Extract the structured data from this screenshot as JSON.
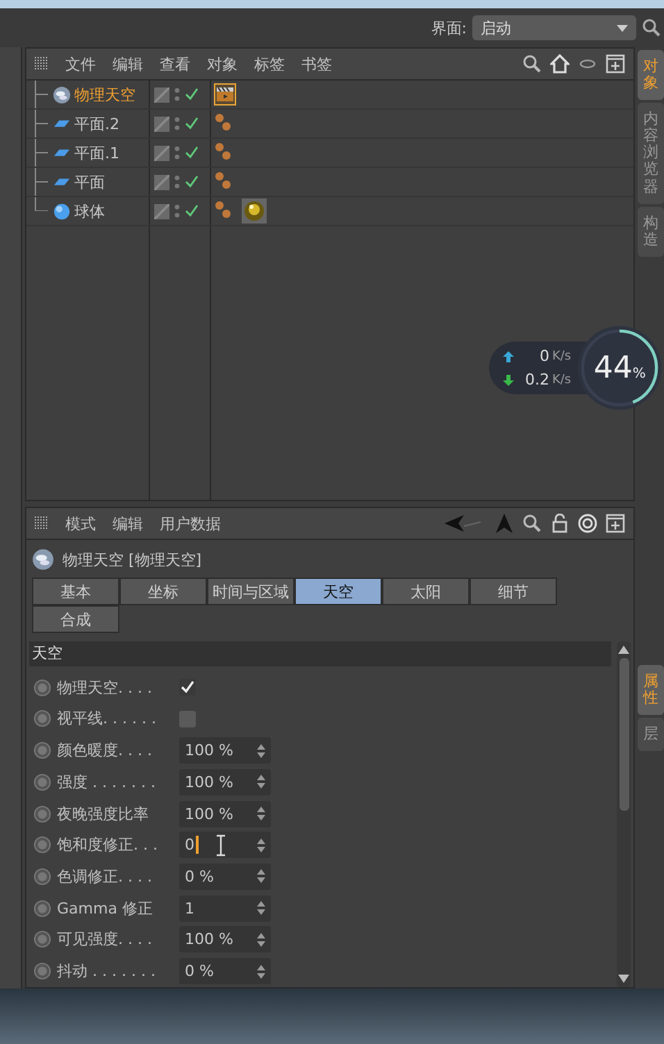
{
  "top_bar": {
    "layout_label": "界面:",
    "layout_value": "启动"
  },
  "object_manager": {
    "menu": [
      "文件",
      "编辑",
      "查看",
      "对象",
      "标签",
      "书签"
    ],
    "objects": [
      {
        "name": "物理天空",
        "kind": "sky",
        "selected": true,
        "tags": [
          {
            "kind": "clapper",
            "selected": true
          }
        ]
      },
      {
        "name": "平面.2",
        "kind": "plane",
        "selected": false,
        "tags": [
          {
            "kind": "dots",
            "selected": false
          }
        ]
      },
      {
        "name": "平面.1",
        "kind": "plane",
        "selected": false,
        "tags": [
          {
            "kind": "dots",
            "selected": false
          }
        ]
      },
      {
        "name": "平面",
        "kind": "plane",
        "selected": false,
        "tags": [
          {
            "kind": "dots",
            "selected": false
          }
        ]
      },
      {
        "name": "球体",
        "kind": "sphere",
        "selected": false,
        "tags": [
          {
            "kind": "dots",
            "selected": false
          },
          {
            "kind": "material",
            "selected": false
          }
        ]
      }
    ]
  },
  "side_tabs_top": [
    {
      "label": "对象",
      "selected": true
    },
    {
      "label": "内容浏览器",
      "selected": false
    },
    {
      "label": "构造",
      "selected": false
    }
  ],
  "net_widget": {
    "upload": "0",
    "upload_unit": "K/s",
    "download": "0.2",
    "download_unit": "K/s",
    "percent": "44",
    "percent_sign": "%",
    "level": 0.44
  },
  "attribute_manager": {
    "menu": [
      "模式",
      "编辑",
      "用户数据"
    ],
    "title": "物理天空 [物理天空]",
    "tabs": [
      {
        "label": "基本",
        "selected": false
      },
      {
        "label": "坐标",
        "selected": false
      },
      {
        "label": "时间与区域",
        "selected": false
      },
      {
        "label": "天空",
        "selected": true
      },
      {
        "label": "太阳",
        "selected": false
      },
      {
        "label": "细节",
        "selected": false
      },
      {
        "label": "合成",
        "selected": false
      }
    ],
    "section": "天空",
    "params": [
      {
        "kind": "checkbox",
        "label": "物理天空. . . .",
        "checked": true
      },
      {
        "kind": "checkbox",
        "label": "视平线. . . . . .",
        "checked": false
      },
      {
        "kind": "number",
        "label": "颜色暖度. . . .",
        "value": "100 %",
        "focused": false
      },
      {
        "kind": "number",
        "label": "强度 . . . . . . .",
        "value": "100 %",
        "focused": false
      },
      {
        "kind": "number",
        "label": "夜晚强度比率",
        "value": "100 %",
        "focused": false
      },
      {
        "kind": "number",
        "label": "饱和度修正. . .",
        "value": "0",
        "focused": true
      },
      {
        "kind": "number",
        "label": "色调修正. . . .",
        "value": "0 %",
        "focused": false
      },
      {
        "kind": "number",
        "label": "Gamma 修正",
        "value": "1",
        "focused": false
      },
      {
        "kind": "number",
        "label": "可见强度. . . .",
        "value": "100 %",
        "focused": false
      },
      {
        "kind": "number",
        "label": "抖动 . . . . . . .",
        "value": "0 %",
        "focused": false
      }
    ]
  },
  "side_tabs_bottom": [
    {
      "label": "属性",
      "selected": true
    },
    {
      "label": "层",
      "selected": false
    }
  ]
}
